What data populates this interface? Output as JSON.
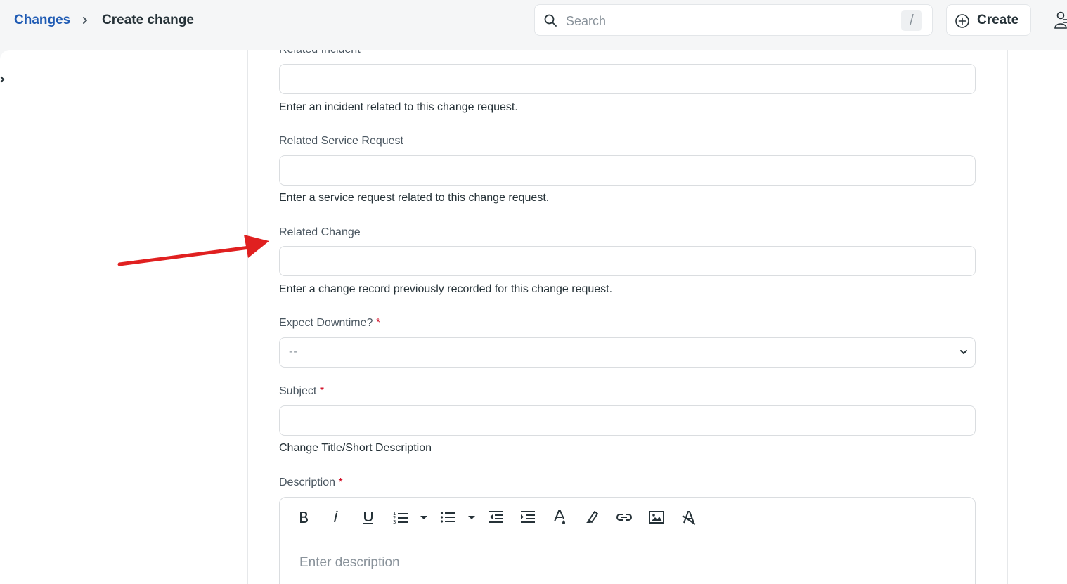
{
  "breadcrumb": {
    "parent": "Changes",
    "current": "Create change"
  },
  "search": {
    "placeholder": "Search",
    "shortcut": "/"
  },
  "header": {
    "create_label": "Create"
  },
  "form": {
    "related_incident": {
      "label": "Related Incident",
      "help": "Enter an incident related to this change request."
    },
    "related_service_request": {
      "label": "Related Service Request",
      "help": "Enter a service request related to this change request."
    },
    "related_change": {
      "label": "Related Change",
      "help": "Enter a change record previously recorded for this change request."
    },
    "expect_downtime": {
      "label": "Expect Downtime?",
      "required_mark": "*",
      "value": "--"
    },
    "subject": {
      "label": "Subject",
      "required_mark": "*",
      "help": "Change Title/Short Description"
    },
    "description": {
      "label": "Description",
      "required_mark": "*",
      "placeholder": "Enter description",
      "toolbar": [
        "bold-icon",
        "italic-icon",
        "underline-icon",
        "ordered-list-icon",
        "list-style-dropdown-icon",
        "bullet-list-icon",
        "bullet-style-dropdown-icon",
        "outdent-icon",
        "indent-icon",
        "text-color-icon",
        "highlight-icon",
        "link-icon",
        "image-icon",
        "clear-format-icon"
      ]
    }
  },
  "colors": {
    "link": "#1f5bb4",
    "required": "#d0021b",
    "annotation_arrow": "#e02020"
  }
}
